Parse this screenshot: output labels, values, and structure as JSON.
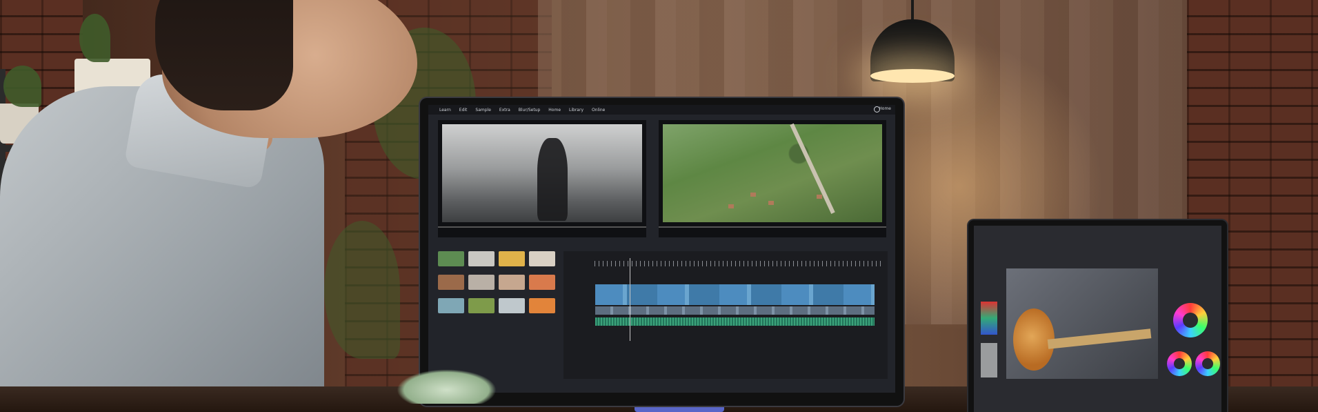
{
  "scene": {
    "colors": {
      "brick": "#5a2f22",
      "monitor_bezel": "#111111",
      "timeline_video": "#4d8cbf",
      "timeline_audio": "#3ba27a",
      "shirt": "#aeb3b7",
      "lamp_glow": "#ffe6b0"
    }
  },
  "monitor": {
    "menu": [
      "Learn",
      "Edit",
      "Sample",
      "Extra",
      "Blur/Setup",
      "Home",
      "Library",
      "Online"
    ],
    "home_label": "Home"
  }
}
